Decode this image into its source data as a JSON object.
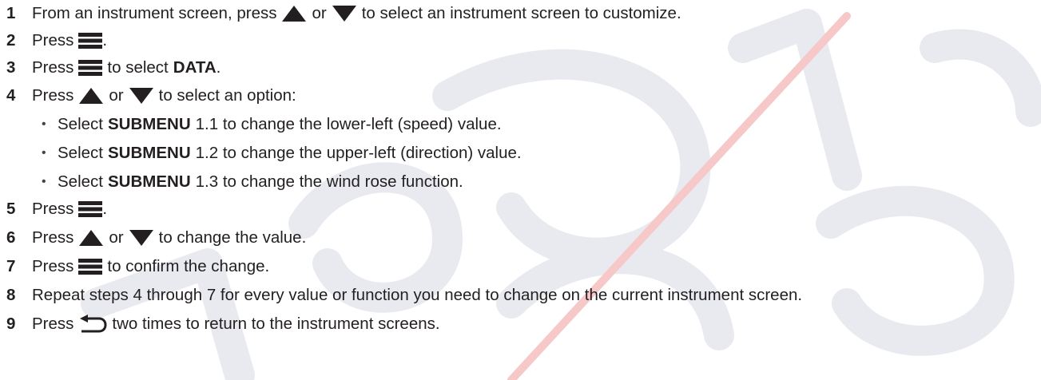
{
  "steps": [
    {
      "num": "1",
      "a": "From an instrument screen, press",
      "or": "or",
      "b": "to select an instrument screen to customize."
    },
    {
      "num": "2",
      "a": "Press",
      "end": "."
    },
    {
      "num": "3",
      "a": "Press",
      "b": "to select",
      "bold": "DATA",
      "end": "."
    },
    {
      "num": "4",
      "a": "Press",
      "or": "or",
      "b": "to select an option:"
    },
    {
      "num": "5",
      "a": "Press",
      "end": "."
    },
    {
      "num": "6",
      "a": "Press",
      "or": "or",
      "b": "to change the value."
    },
    {
      "num": "7",
      "a": "Press",
      "b": "to confirm the change."
    },
    {
      "num": "8",
      "a": "Repeat steps 4 through 7 for every value or function you need to change on the current instrument screen."
    },
    {
      "num": "9",
      "a": "Press",
      "b": "two times to return to the instrument screens."
    }
  ],
  "options": [
    {
      "bullet": "•",
      "pre": "Select",
      "bold": "SUBMENU",
      "text": "1.1 to change the lower-left (speed) value."
    },
    {
      "bullet": "•",
      "pre": "Select",
      "bold": "SUBMENU",
      "text": "1.2 to change the upper-left (direction) value."
    },
    {
      "bullet": "•",
      "pre": "Select",
      "bold": "SUBMENU",
      "text": "1.3 to change the wind rose function."
    }
  ],
  "icons": {
    "up": "up-arrow-icon",
    "down": "down-arrow-icon",
    "menu": "menu-icon",
    "back": "back-icon"
  },
  "colors": {
    "text": "#231f20",
    "number": "#231f20",
    "watermark": "#e8eaf0",
    "watermark_accent": "#f7c8c8"
  }
}
